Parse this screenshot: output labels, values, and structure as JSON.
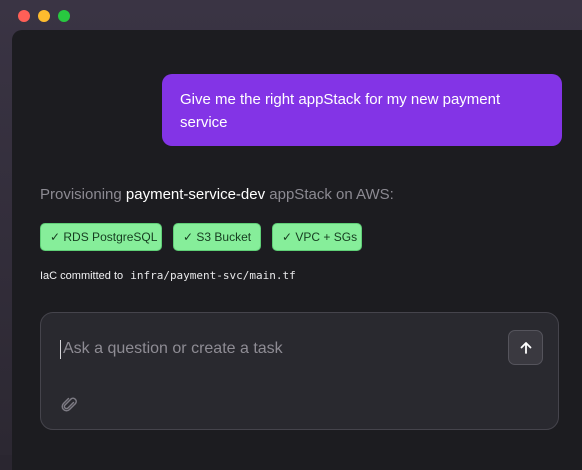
{
  "window": {
    "controls": [
      "close",
      "minimize",
      "zoom"
    ],
    "colors": {
      "close": "#ff5f57",
      "minimize": "#febc2e",
      "zoom": "#28c840"
    }
  },
  "chat": {
    "user_message": "Give me the right appStack for my new payment service",
    "assistant": {
      "provisioning_prefix": "Provisioning",
      "stack_name": "payment-service-dev",
      "provisioning_suffix": "appStack on AWS:",
      "resources": [
        {
          "label": "✓ RDS PostgreSQL"
        },
        {
          "label": "✓ S3 Bucket"
        },
        {
          "label": "✓ VPC + SGs"
        }
      ],
      "iac_prefix": "IaC committed to",
      "iac_path": "infra/payment-svc/main.tf"
    }
  },
  "composer": {
    "placeholder": "Ask a question or create a task",
    "value": "",
    "send_icon": "arrow-up-icon",
    "attach_icon": "paperclip-icon"
  },
  "colors": {
    "accent": "#8334e6",
    "success_chip": "#86ee9a"
  }
}
